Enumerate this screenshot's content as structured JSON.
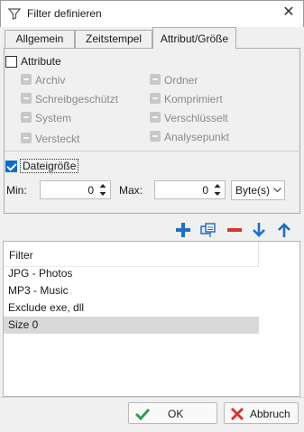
{
  "window": {
    "title": "Filter definieren",
    "close_glyph": "✕",
    "icon": "filter-funnel-icon"
  },
  "tabs": [
    {
      "label": "Allgemein",
      "active": false
    },
    {
      "label": "Zeitstempel",
      "active": false
    },
    {
      "label": "Attribut/Größe",
      "active": true
    }
  ],
  "attributes": {
    "label": "Attribute",
    "checked": false,
    "items_left": [
      "Archiv",
      "Schreibgeschützt",
      "System",
      "Versteckt"
    ],
    "items_right": [
      "Ordner",
      "Komprimiert",
      "Verschlüsselt",
      "Analysepunkt"
    ]
  },
  "filesize": {
    "label": "Dateigröße",
    "checked": true,
    "min_label": "Min:",
    "min_value": "0",
    "max_label": "Max:",
    "max_value": "0",
    "unit": "Byte(s)"
  },
  "toolbar": {
    "icons": [
      "plus-icon",
      "copy-icon",
      "minus-icon",
      "arrow-down-icon",
      "arrow-up-icon"
    ],
    "colors": {
      "blue": "#1e6fc9",
      "red": "#d8352b"
    }
  },
  "list": {
    "header": "Filter",
    "rows": [
      "JPG - Photos",
      "MP3 - Music",
      "Exclude exe, dll",
      "Size 0"
    ],
    "selected_index": 3
  },
  "buttons": {
    "ok_label": "OK",
    "cancel_label": "Abbruch",
    "ok_icon": "check-icon",
    "cancel_icon": "x-icon",
    "ok_color": "#2ea043",
    "cancel_color": "#d8352b"
  }
}
